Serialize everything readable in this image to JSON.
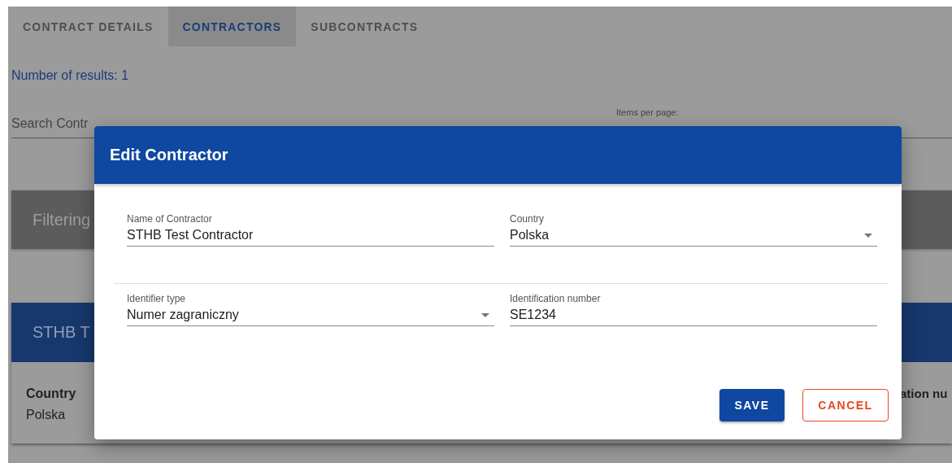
{
  "tabs": [
    {
      "label": "CONTRACT DETAILS",
      "selected": false
    },
    {
      "label": "CONTRACTORS",
      "selected": true
    },
    {
      "label": "SUBCONTRACTS",
      "selected": false
    }
  ],
  "results_count": "Number of results: 1",
  "search": {
    "placeholder": "Search Contr"
  },
  "items_per_page": {
    "label": "Items per page:"
  },
  "filtering_title": "Filtering",
  "contractor_card": {
    "title": "STHB T",
    "fields": [
      {
        "label": "Country",
        "value": "Polska"
      }
    ],
    "column_heading_cut": "ation nu"
  },
  "dialog": {
    "title": "Edit Contractor",
    "rows": [
      [
        {
          "label": "Name of Contractor",
          "value": "STHB Test Contractor",
          "kind": "text"
        },
        {
          "label": "Country",
          "value": "Polska",
          "kind": "select"
        }
      ],
      [
        {
          "label": "Identifier type",
          "value": "Numer zagraniczny",
          "kind": "select"
        },
        {
          "label": "Identification number",
          "value": "SE1234",
          "kind": "text"
        }
      ]
    ],
    "buttons": [
      {
        "label": "SAVE",
        "kind": "primary"
      },
      {
        "label": "CANCEL",
        "kind": "outlined"
      }
    ]
  }
}
